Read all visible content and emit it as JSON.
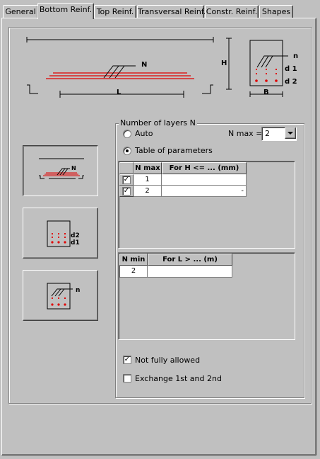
{
  "tabs": [
    {
      "label": "General"
    },
    {
      "label": "Bottom Reinf."
    },
    {
      "label": "Top Reinf."
    },
    {
      "label": "Transversal Reinf."
    },
    {
      "label": "Constr. Reinf."
    },
    {
      "label": "Shapes"
    }
  ],
  "active_tab": "Bottom Reinf.",
  "diagram": {
    "beam_label_N": "N",
    "beam_label_L": "L",
    "beam_label_H": "H",
    "section_label_n": "n",
    "section_label_d1": "d 1",
    "section_label_d2": "d 2",
    "section_label_B": "B"
  },
  "side_buttons": {
    "beam_N": "N",
    "section_d2": "d2",
    "section_d1": "d1",
    "section_n": "n"
  },
  "layers_group": {
    "title": "Number of layers N",
    "auto_label": "Auto",
    "table_label": "Table of parameters",
    "selected": "table",
    "nmax_label": "N max =",
    "nmax_value": "2"
  },
  "table_h": {
    "headers": [
      "N max",
      "For H <= ... (mm)"
    ],
    "rows": [
      {
        "checked": true,
        "nmax": "1",
        "h": ""
      },
      {
        "checked": true,
        "nmax": "2",
        "h": "-"
      }
    ]
  },
  "table_l": {
    "headers": [
      "N min",
      "For L > ... (m)"
    ],
    "rows": [
      {
        "nmin": "2",
        "l": ""
      }
    ]
  },
  "options": {
    "not_fully_allowed": {
      "label": "Not fully allowed",
      "checked": true
    },
    "exchange": {
      "label": "Exchange 1st and 2nd",
      "checked": false
    }
  },
  "colors": {
    "rebar": "#e00000",
    "face": "#c0c0c0"
  }
}
